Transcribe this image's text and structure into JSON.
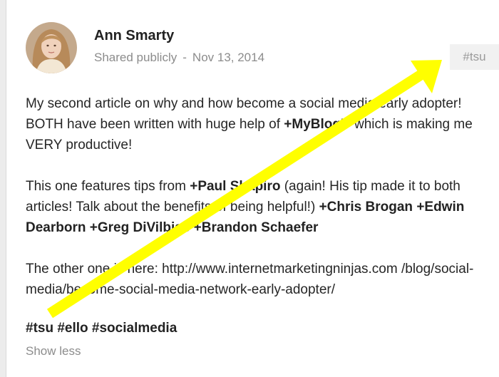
{
  "post": {
    "author": "Ann Smarty",
    "visibility": "Shared publicly",
    "separator": "-",
    "date": "Nov 13, 2014",
    "tag_chip": "#tsu",
    "paragraph1": {
      "t1": "My second article on why and how become a social media early adopter! BOTH have been written with huge help of ",
      "m1": "+MyBlogU",
      "t2": " which is making me VERY productive!"
    },
    "paragraph2": {
      "t1": "This one features tips from ",
      "m1": "+Paul Shapiro",
      "t2": " (again! His tip made it to both articles! Talk about the benefits of being helpful!) ",
      "m2": "+Chris Brogan",
      "t3": " ",
      "m3": "+Edwin Dearborn",
      "t4": " ",
      "m4": "+Greg DiVilbiss",
      "t5": " ",
      "m5": "+Brandon Schaefer"
    },
    "paragraph3": {
      "t1": "The other one is here: http://www.internetmarketingninjas.com /blog/social-media/become-social-media-network-early-adopter/"
    },
    "hashtags": "#tsu #ello #socialmedia",
    "show_less": "Show less"
  },
  "colors": {
    "arrow": "#ffff00",
    "meta_text": "#8c8c8c",
    "chip_bg": "#f1f1f1"
  },
  "icons": {
    "avatar": "author-avatar",
    "overlay": "yellow-annotation-arrow"
  }
}
